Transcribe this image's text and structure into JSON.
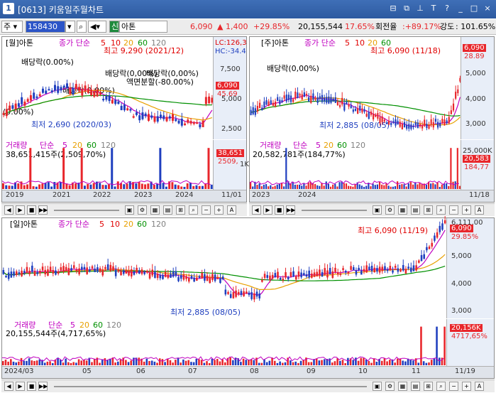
{
  "window": {
    "number": "1",
    "title": "[0613] 키움일주월차트",
    "buttons": [
      "⊟",
      "⧉",
      "⊥",
      "T",
      "?",
      "_",
      "□",
      "×"
    ]
  },
  "toolbar": {
    "market": "주",
    "code": "158430",
    "credit_badge": "신",
    "name": "아톤",
    "price": "6,090",
    "arrow": "▲",
    "change": "1,400",
    "change_pct": "+29.85%",
    "volume": "20,155,544",
    "vol_ratio": "17.65%",
    "turnover_label": "회전율",
    "turnover": ":+89.17%",
    "strength_label": "강도",
    "strength": ": 101.65%"
  },
  "monthly": {
    "header": "[월]아톤",
    "ma_label": "종가 단순",
    "ma": [
      "5",
      "10",
      "20",
      "60",
      "120"
    ],
    "high_note": "최고 9,290 (2021/12)",
    "low_note": "최저 2,690 (2020/03)",
    "div1": "배당락(0.00%)",
    "div2": "배당락(0,00%)",
    "div3": "배당락(0,00%)",
    "div4": "배당락(0.00%)",
    "split": "액면분할(-80.00%)",
    "left_note": "(0.00%)",
    "lc": "LC:126,3",
    "hc": "HC:-34.4",
    "price_tag": "6,090",
    "pct_tag": "45.69",
    "yticks": [
      "7,500",
      "5,000",
      "2,500"
    ],
    "vol_header": "거래량",
    "vol_ma_label": "단순",
    "vol_ma": [
      "5",
      "20",
      "60",
      "120"
    ],
    "vol_value": "38,651,415주(2,509,70%)",
    "vol_tag": "38,651",
    "vol_tag2": "2509,",
    "vol_tick": "1K",
    "xticks": [
      "2019",
      "2021",
      "2022",
      "2023",
      "2024",
      "11/01"
    ]
  },
  "weekly": {
    "header": "[주]아톤",
    "ma_label": "종가 단순",
    "ma": [
      "5",
      "10",
      "20",
      "60",
      "120"
    ],
    "high_note": "최고 6,090 (11/18)",
    "low_note": "최저 2,885 (08/05)",
    "div": "배당락(0,00%)",
    "price_tag": "6,090",
    "pct_tag": "28.89",
    "yticks": [
      "5,000",
      "4,000",
      "3,000"
    ],
    "vol_header": "거래량",
    "vol_ma_label": "단순",
    "vol_ma": [
      "5",
      "20",
      "60",
      "120"
    ],
    "vol_value": "20,582,781주(184,77%)",
    "vol_tag": "20,583",
    "vol_tag2": "184,77",
    "vol_tick": "25,000K",
    "xticks": [
      "2023",
      "2024",
      "11/18"
    ]
  },
  "daily": {
    "header": "[일]아톤",
    "ma_label": "종가 단순",
    "ma": [
      "5",
      "10",
      "20",
      "60",
      "120"
    ],
    "high_note": "최고 6,090 (11/19)",
    "low_note": "최저 2,885 (08/05)",
    "top_tick": "6,111.00",
    "price_tag": "6,090",
    "pct_tag": "29.85%",
    "yticks": [
      "5,000",
      "4,000",
      "3,000"
    ],
    "vol_header": "거래량",
    "vol_ma_label": "단순",
    "vol_ma": [
      "5",
      "20",
      "60",
      "120"
    ],
    "vol_value": "20,155,544주(4,717,65%)",
    "vol_tag": "20,156K",
    "vol_tag2": "4717,65%",
    "xticks": [
      "2024/03",
      "05",
      "06",
      "07",
      "08",
      "09",
      "10",
      "11",
      "11/19"
    ]
  },
  "colors": {
    "up": "#e8262b",
    "down": "#1f3fbf",
    "ma5": "#c000c0",
    "ma10": "#e00000",
    "ma20": "#e8a000",
    "ma60": "#009000",
    "ma120": "#808080",
    "axis_bg": "#e8eef8"
  }
}
